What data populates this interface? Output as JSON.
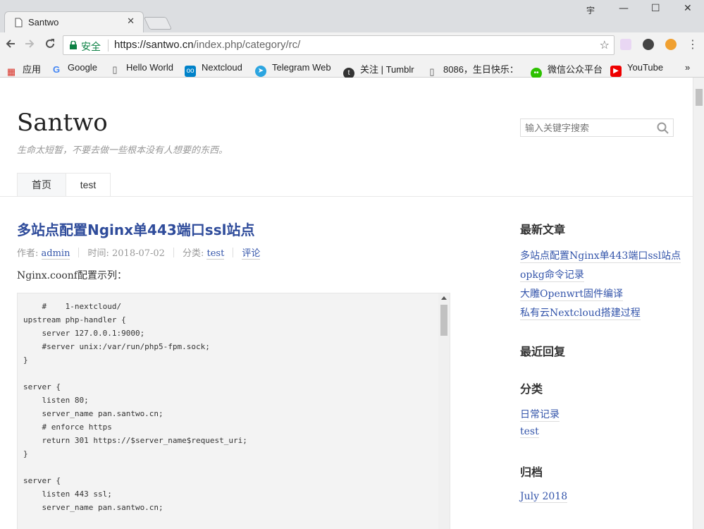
{
  "browser": {
    "tab_title": "Santwo",
    "tab_close": "✕",
    "window_controls": {
      "user": "宇",
      "minimize": "—",
      "maximize": "☐",
      "close": "✕"
    },
    "secure_label": "安全",
    "url_host": "https://santwo.cn",
    "url_path": "/index.php/category/rc/",
    "bookmarks": [
      {
        "label": "应用",
        "icon": "apps-grid-icon"
      },
      {
        "label": "Google",
        "icon": "google-icon"
      },
      {
        "label": "Hello World",
        "icon": "page-icon"
      },
      {
        "label": "Nextcloud",
        "icon": "nextcloud-icon"
      },
      {
        "label": "Telegram Web",
        "icon": "telegram-icon"
      },
      {
        "label": "关注 | Tumblr",
        "icon": "tumblr-icon"
      },
      {
        "label": "8086，生日快乐：",
        "icon": "page-icon"
      },
      {
        "label": "微信公众平台",
        "icon": "wechat-icon"
      },
      {
        "label": "YouTube",
        "icon": "youtube-icon"
      }
    ],
    "more_bookmarks": "»"
  },
  "site": {
    "title": "Santwo",
    "tagline": "生命太短暂，不要去做一些根本没有人想要的东西。",
    "search_placeholder": "输入关键字搜索",
    "nav": [
      "首页",
      "test"
    ]
  },
  "post": {
    "title": "多站点配置Nginx单443端口ssl站点",
    "author_label": "作者:",
    "author": "admin",
    "time_label": "时间:",
    "time": "2018-07-02",
    "category_label": "分类:",
    "category": "test",
    "comments": "评论",
    "intro": "Nginx.coonf配置示列：",
    "code": "    #    1-nextcloud/\nupstream php-handler {\n    server 127.0.0.1:9000;\n    #server unix:/var/run/php5-fpm.sock;\n}\n\nserver {\n    listen 80;\n    server_name pan.santwo.cn;\n    # enforce https\n    return 301 https://$server_name$request_uri;\n}\n\nserver {\n    listen 443 ssl;\n    server_name pan.santwo.cn;"
  },
  "sidebar": {
    "recent_title": "最新文章",
    "recent": [
      "多站点配置Nginx单443端口ssl站点",
      "opkg命令记录",
      "大雕Openwrt固件编译",
      "私有云Nextcloud搭建过程"
    ],
    "replies_title": "最近回复",
    "categories_title": "分类",
    "categories": [
      "日常记录",
      "test"
    ],
    "archive_title": "归档",
    "archives": [
      "July 2018"
    ]
  }
}
